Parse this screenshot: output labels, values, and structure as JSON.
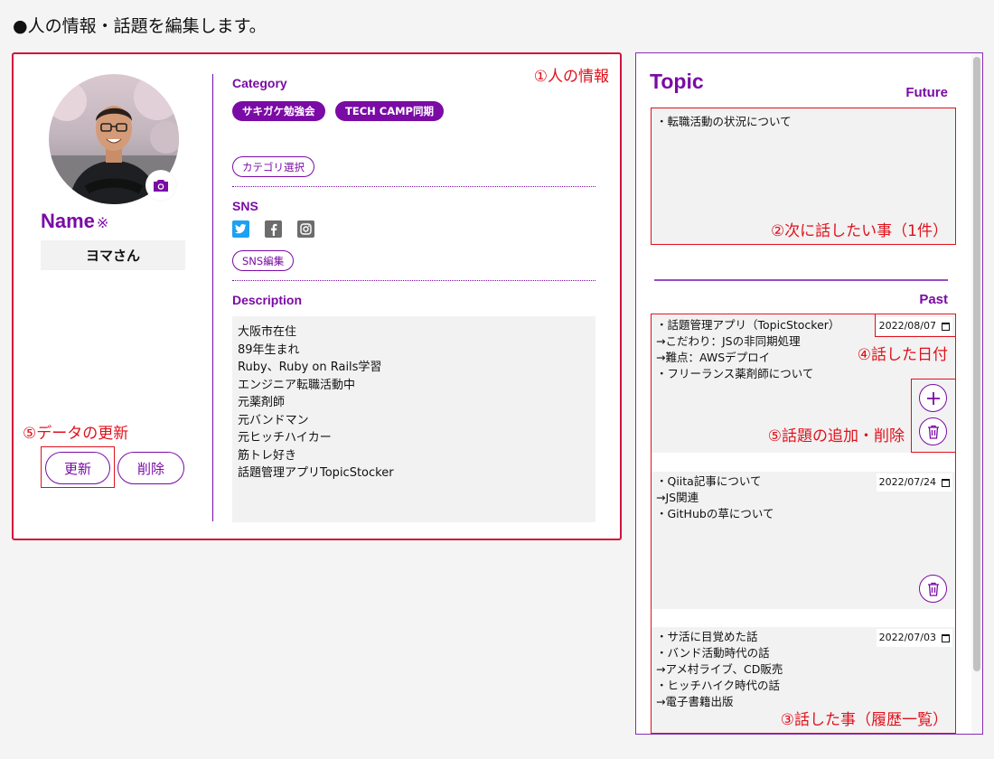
{
  "page": {
    "heading": "●人の情報・話題を編集します。"
  },
  "person": {
    "annotation": "①人の情報",
    "name_label": "Name",
    "name_required": "※",
    "name_value": "ヨマさん",
    "update_annotation": "⑤データの更新",
    "update_label": "更新",
    "delete_label": "削除",
    "category_title": "Category",
    "categories": [
      "サキガケ勉強会",
      "TECH CAMP同期"
    ],
    "category_select_label": "カテゴリ選択",
    "sns_title": "SNS",
    "sns_icons": [
      "twitter-icon",
      "facebook-icon",
      "instagram-icon"
    ],
    "sns_edit_label": "SNS編集",
    "description_title": "Description",
    "description": [
      "大阪市在住",
      "89年生まれ",
      "Ruby、Ruby on Rails学習",
      "エンジニア転職活動中",
      "元薬剤師",
      "元バンドマン",
      "元ヒッチハイカー",
      "筋トレ好き",
      "話題管理アプリTopicStocker"
    ]
  },
  "topic": {
    "title": "Topic",
    "future_label": "Future",
    "future_text": "・転職活動の状況について",
    "future_annotation": "②次に話したい事（1件）",
    "past_label": "Past",
    "date_annotation": "④話した日付",
    "add_delete_annotation": "⑤話題の追加・削除",
    "history_annotation": "③話した事（履歴一覧）",
    "past_items": [
      {
        "date": "2022/08/07",
        "lines": [
          "・話題管理アプリ（TopicStocker）",
          "→こだわり：JSの非同期処理",
          "→難点：AWSデプロイ",
          "・フリーランス薬剤師について"
        ]
      },
      {
        "date": "2022/07/24",
        "lines": [
          "・Qiita記事について",
          "→JS関連",
          "・GitHubの草について"
        ]
      },
      {
        "date": "2022/07/03",
        "lines": [
          "・サ活に目覚めた話",
          "・バンド活動時代の話",
          "→アメ村ライブ、CD販売",
          "・ヒッチハイク時代の話",
          "→電子書籍出版"
        ]
      }
    ]
  },
  "colors": {
    "accent": "#7a0ba5",
    "annotation": "#e0111c",
    "twitter": "#1da1f2"
  }
}
